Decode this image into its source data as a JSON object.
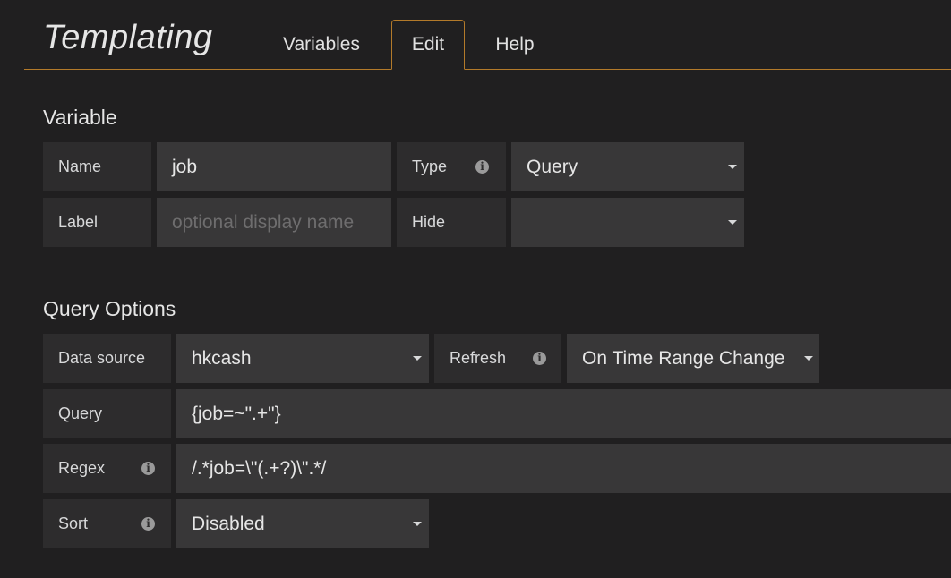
{
  "header": {
    "title": "Templating",
    "tabs": [
      {
        "label": "Variables"
      },
      {
        "label": "Edit",
        "active": true
      },
      {
        "label": "Help"
      }
    ]
  },
  "variable": {
    "section_title": "Variable",
    "name_label": "Name",
    "name_value": "job",
    "type_label": "Type",
    "type_value": "Query",
    "label_label": "Label",
    "label_placeholder": "optional display name",
    "hide_label": "Hide",
    "hide_value": ""
  },
  "query_options": {
    "section_title": "Query Options",
    "datasource_label": "Data source",
    "datasource_value": "hkcash",
    "refresh_label": "Refresh",
    "refresh_value": "On Time Range Change",
    "query_label": "Query",
    "query_value": "{job=~\".+\"}",
    "regex_label": "Regex",
    "regex_value": "/.*job=\\\"(.+?)\\\".*/",
    "sort_label": "Sort",
    "sort_value": "Disabled"
  },
  "icons": {
    "info": "i"
  },
  "colors": {
    "accent": "#b37a2a",
    "background": "#201f20",
    "label_bg": "#2d2c2d",
    "input_bg": "#383738"
  }
}
